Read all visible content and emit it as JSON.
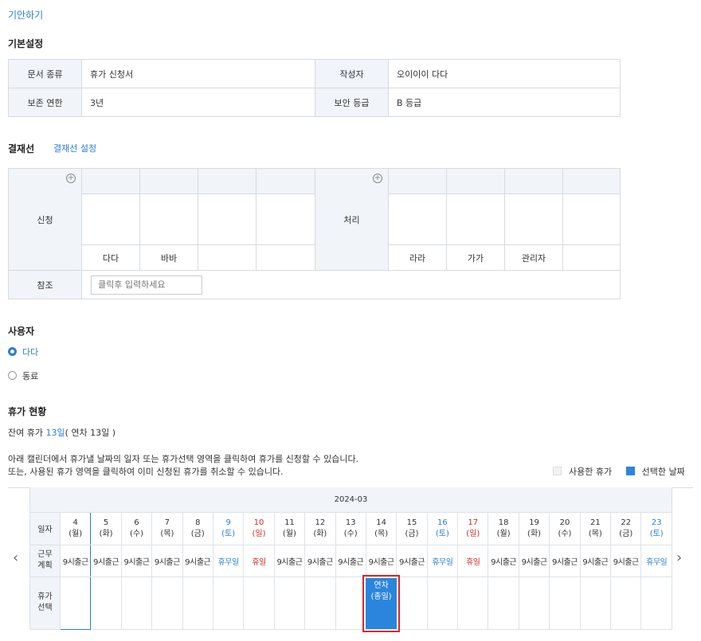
{
  "top_link": "기안하기",
  "basic": {
    "title": "기본설정",
    "doc_type_label": "문서 종류",
    "doc_type_value": "휴가 신청서",
    "author_label": "작성자",
    "author_value": "오이이이 다다",
    "retention_label": "보존 연한",
    "retention_value": "3년",
    "security_label": "보안 등급",
    "security_value": "B 등급"
  },
  "approval": {
    "title": "결재선",
    "setting_link": "결재선 설정",
    "request_label": "신청",
    "process_label": "처리",
    "request_names": [
      "다다",
      "바바",
      "",
      ""
    ],
    "process_names": [
      "라라",
      "가가",
      "관리자",
      ""
    ],
    "reference_label": "참조",
    "reference_placeholder": "클릭후 입력하세요"
  },
  "user": {
    "title": "사용자",
    "options": [
      {
        "label": "다다",
        "selected": true
      },
      {
        "label": "동료",
        "selected": false
      }
    ]
  },
  "vacation": {
    "title": "휴가 현황",
    "remaining_prefix": "잔여 휴가 ",
    "remaining_days": "13일",
    "remaining_suffix": "( 연차 13일 )",
    "instruction1": "아래 캘린더에서 휴가낼 날짜의 일자 또는 휴가선택 영역을 클릭하여 휴가를 신청할 수 있습니다.",
    "instruction2": "또는, 사용된 휴가 영역을 클릭하여 이미 신청된 휴가를 취소할 수 있습니다.",
    "legend_used": "사용한 휴가",
    "legend_selected": "선택한 날짜",
    "used_color": "#f2f2f2",
    "selected_color": "#2a86dc",
    "month": "2024-03",
    "row_labels": {
      "date": "일자",
      "plan": "근무\n계획",
      "select": "휴가\n선택"
    },
    "days": [
      {
        "d": "4",
        "w": "(월)",
        "plan": "9시출근",
        "c": "n"
      },
      {
        "d": "5",
        "w": "(화)",
        "plan": "9시출근",
        "c": "n"
      },
      {
        "d": "6",
        "w": "(수)",
        "plan": "9시출근",
        "c": "n"
      },
      {
        "d": "7",
        "w": "(목)",
        "plan": "9시출근",
        "c": "n"
      },
      {
        "d": "8",
        "w": "(금)",
        "plan": "9시출근",
        "c": "n"
      },
      {
        "d": "9",
        "w": "(토)",
        "plan": "휴무일",
        "c": "b"
      },
      {
        "d": "10",
        "w": "(일)",
        "plan": "휴일",
        "c": "r"
      },
      {
        "d": "11",
        "w": "(월)",
        "plan": "9시출근",
        "c": "n"
      },
      {
        "d": "12",
        "w": "(화)",
        "plan": "9시출근",
        "c": "n"
      },
      {
        "d": "13",
        "w": "(수)",
        "plan": "9시출근",
        "c": "n"
      },
      {
        "d": "14",
        "w": "(목)",
        "plan": "9시출근",
        "c": "n"
      },
      {
        "d": "15",
        "w": "(금)",
        "plan": "9시출근",
        "c": "n"
      },
      {
        "d": "16",
        "w": "(토)",
        "plan": "휴무일",
        "c": "b"
      },
      {
        "d": "17",
        "w": "(일)",
        "plan": "휴일",
        "c": "r"
      },
      {
        "d": "18",
        "w": "(월)",
        "plan": "9시출근",
        "c": "n"
      },
      {
        "d": "19",
        "w": "(화)",
        "plan": "9시출근",
        "c": "n"
      },
      {
        "d": "20",
        "w": "(수)",
        "plan": "9시출근",
        "c": "n"
      },
      {
        "d": "21",
        "w": "(목)",
        "plan": "9시출근",
        "c": "n"
      },
      {
        "d": "22",
        "w": "(금)",
        "plan": "9시출근",
        "c": "n"
      },
      {
        "d": "23",
        "w": "(토)",
        "plan": "휴무일",
        "c": "b"
      }
    ],
    "selection": {
      "day_index": 10,
      "line1": "연차",
      "line2": "(종일)"
    },
    "prev_icon": "chevron-left-icon",
    "next_icon": "chevron-right-icon"
  }
}
